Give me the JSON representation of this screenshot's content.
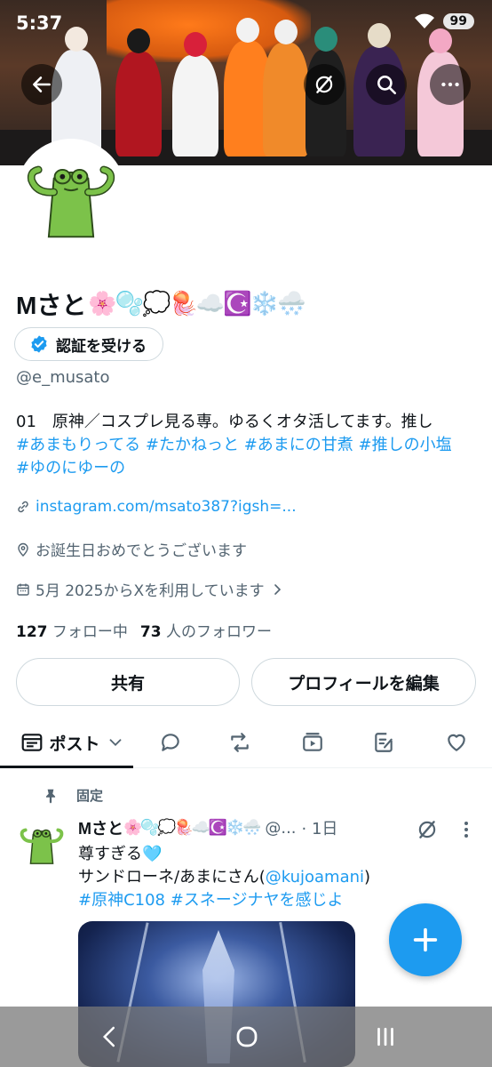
{
  "status_bar": {
    "time": "5:37",
    "battery": "99"
  },
  "header": {
    "back_icon": "arrow-left-icon",
    "grok_icon": "grok-icon",
    "search_icon": "search-icon",
    "more_icon": "more-horizontal-icon"
  },
  "profile": {
    "display_name": "Mさと",
    "name_emojis": "🌸🫧💭🪼☁️☪️❄️🌨️",
    "verify_label": "認証を受ける",
    "handle": "@e_musato",
    "bio_text": "01　原神／コスプレ見る専。ゆるくオタ活してます。推し",
    "bio_tags_line1": "#あまもりってる #たかねっと #あまにの甘煮 #推しの小塩",
    "bio_tags_line2": "#ゆのにゆーの",
    "link": "instagram.com/msato387?igsh=...",
    "birthday": "お誕生日おめでとうございます",
    "joined": "5月 2025からXを利用しています",
    "following_count": "127",
    "following_label": "フォロー中",
    "followers_count": "73",
    "followers_label": "人のフォロワー",
    "share_label": "共有",
    "edit_label": "プロフィールを編集"
  },
  "tabs": {
    "posts_label": "ポスト"
  },
  "pinned_post": {
    "pinned_label": "固定",
    "author_name": "Mさと",
    "author_emojis": "🌸🫧💭🪼☁️☪️❄️🌨️",
    "author_handle": "@...",
    "time": "· 1日",
    "line1": "尊すぎる🩵",
    "line2_prefix": "サンドローネ/あまにさん(",
    "mention": "@kujoamani",
    "line2_suffix": ")",
    "tags": "#原神C108 #スネージナヤを感じよ"
  },
  "colors": {
    "accent": "#1d9bf0",
    "text": "#0f1419",
    "secondary": "#536471",
    "verified": "#1d9bf0"
  }
}
